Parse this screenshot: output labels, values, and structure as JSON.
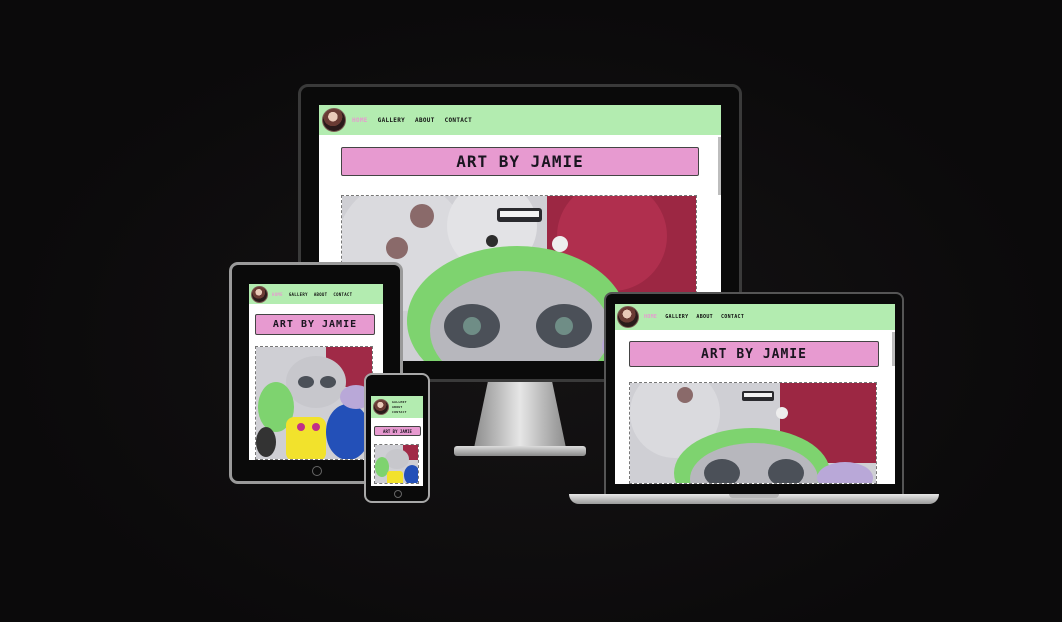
{
  "site": {
    "title": "ART BY JAMIE",
    "nav": {
      "home": "HOME",
      "gallery": "GALLERY",
      "about": "ABOUT",
      "contact": "CONTACT"
    }
  },
  "colors": {
    "nav_bg": "#b3ecb0",
    "title_bg": "#e79ad0",
    "active_link": "#e79ad0",
    "background": "#0d0b0c"
  },
  "devices": [
    "desktop-monitor",
    "tablet",
    "phone",
    "laptop"
  ],
  "image": {
    "alt_subject": "plush creature art collage"
  }
}
